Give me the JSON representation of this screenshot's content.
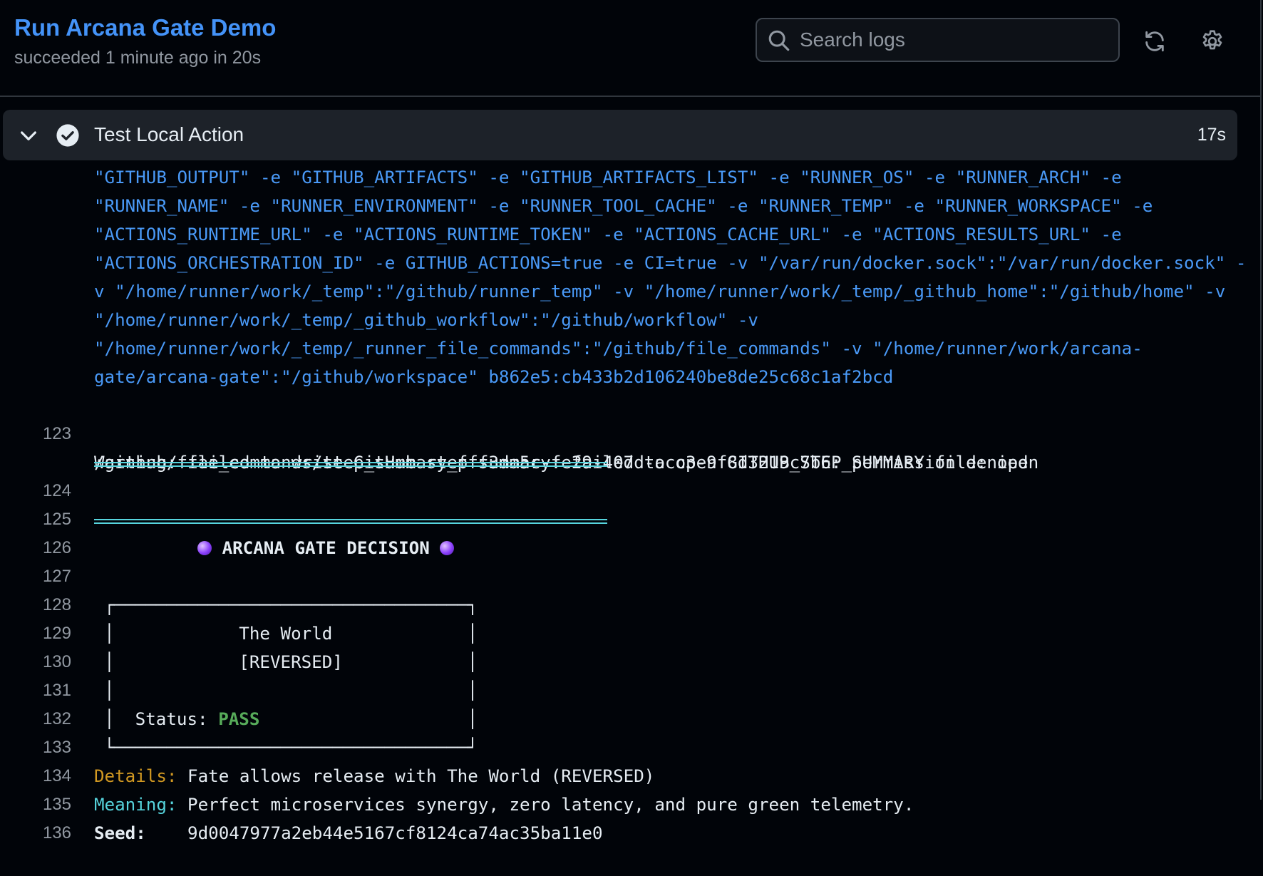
{
  "header": {
    "title": "Run Arcana Gate Demo",
    "subtitle": "succeeded 1 minute ago in 20s",
    "search_placeholder": "Search logs",
    "icons": [
      "search-icon",
      "refresh-icon",
      "gear-icon"
    ]
  },
  "step": {
    "name": "Test Local Action",
    "duration": "17s",
    "icons": [
      "chevron-down-icon",
      "check-circle-icon"
    ]
  },
  "log": {
    "wrapped": [
      "\"GITHUB_OUTPUT\" -e \"GITHUB_ARTIFACTS\" -e \"GITHUB_ARTIFACTS_LIST\" -e \"RUNNER_OS\" -e \"RUNNER_ARCH\" -e",
      "\"RUNNER_NAME\" -e \"RUNNER_ENVIRONMENT\" -e \"RUNNER_TOOL_CACHE\" -e \"RUNNER_TEMP\" -e \"RUNNER_WORKSPACE\" -e",
      "\"ACTIONS_RUNTIME_URL\" -e \"ACTIONS_RUNTIME_TOKEN\" -e \"ACTIONS_CACHE_URL\" -e \"ACTIONS_RESULTS_URL\" -e",
      "\"ACTIONS_ORCHESTRATION_ID\" -e GITHUB_ACTIONS=true -e CI=true -v \"/var/run/docker.sock\":\"/var/run/docker.sock\" -",
      "v \"/home/runner/work/_temp\":\"/github/runner_temp\" -v \"/home/runner/work/_temp/_github_home\":\"/github/home\" -v",
      "\"/home/runner/work/_temp/_github_workflow\":\"/github/workflow\" -v",
      "\"/home/runner/work/_temp/_runner_file_commands\":\"/github/file_commands\" -v \"/home/runner/work/arcana-",
      "gate/arcana-gate\":\"/github/workspace\" b862e5:cb433b2d106240be8de25c68c1af2bcd"
    ],
    "line_numbers": [
      "123",
      "124",
      "125",
      "126",
      "127",
      "128",
      "129",
      "130",
      "131",
      "132",
      "133",
      "134",
      "135",
      "136"
    ],
    "warning": [
      "Warning: failed to write GitHub step summary: failed to open GITHUB_STEP_SUMMARY file: open",
      "/github/file_commands/step_summary_fff3da5c-fe29-407d-acc3-9f8d3219c7b6: permission denied"
    ],
    "decision_title": "ARCANA GATE DECISION",
    "box_top": "┌──────────────────────────────────┐",
    "box_line_1": "│            The World             │",
    "box_line_2": "│            [REVERSED]            │",
    "box_line_3": "│                                  │",
    "box_status_prefix": "│  Status: ",
    "box_status_value": "PASS",
    "box_status_suffix": "                    │",
    "box_bottom": "└──────────────────────────────────┘",
    "details_label": "Details:",
    "details_value": " Fate allows release with The World (REVERSED)",
    "meaning_label": "Meaning:",
    "meaning_value": " Perfect microservices synergy, zero latency, and pure green telemetry.",
    "seed_label": "Seed:",
    "seed_value": "    9d0047977a2eb44e5167cf8124ca74ac35ba11e0"
  },
  "colors": {
    "accent_link": "#4493f8",
    "command_text": "#4a9af8",
    "pass_green": "#57ab5a",
    "details_gold": "#d29922",
    "meaning_cyan": "#56d4dd",
    "background": "#010409"
  }
}
